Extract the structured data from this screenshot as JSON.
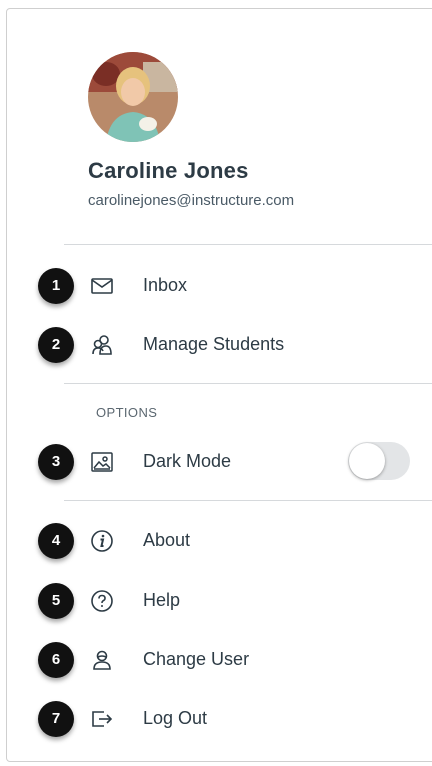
{
  "profile": {
    "name": "Caroline Jones",
    "email": "carolinejones@instructure.com",
    "avatar_icon": "user-photo"
  },
  "menu": {
    "items": [
      {
        "badge": "1",
        "label": "Inbox",
        "icon": "envelope-icon"
      },
      {
        "badge": "2",
        "label": "Manage Students",
        "icon": "users-icon"
      }
    ]
  },
  "options": {
    "section_label": "OPTIONS",
    "dark_mode": {
      "badge": "3",
      "label": "Dark Mode",
      "icon": "image-icon",
      "enabled": false
    }
  },
  "footer_menu": {
    "items": [
      {
        "badge": "4",
        "label": "About",
        "icon": "info-icon"
      },
      {
        "badge": "5",
        "label": "Help",
        "icon": "question-icon"
      },
      {
        "badge": "6",
        "label": "Change User",
        "icon": "user-icon"
      },
      {
        "badge": "7",
        "label": "Log Out",
        "icon": "logout-icon"
      }
    ]
  },
  "colors": {
    "text": "#2d3b45",
    "badge": "#111111",
    "toggle_off": "#e3e5e7"
  }
}
